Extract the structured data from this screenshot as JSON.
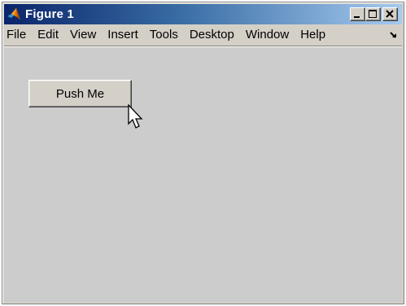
{
  "window": {
    "title": "Figure 1",
    "controls": {
      "minimize": "minimize-icon",
      "maximize": "maximize-icon",
      "close": "close-icon"
    }
  },
  "menubar": {
    "items": [
      "File",
      "Edit",
      "View",
      "Insert",
      "Tools",
      "Desktop",
      "Window",
      "Help"
    ],
    "overflow_icon": "dock-arrow-icon"
  },
  "figure": {
    "button_label": "Push Me",
    "background_color": "#cccccc"
  },
  "colors": {
    "title_gradient_start": "#0a246a",
    "title_gradient_end": "#a6caf0",
    "chrome": "#d4d0c8"
  }
}
